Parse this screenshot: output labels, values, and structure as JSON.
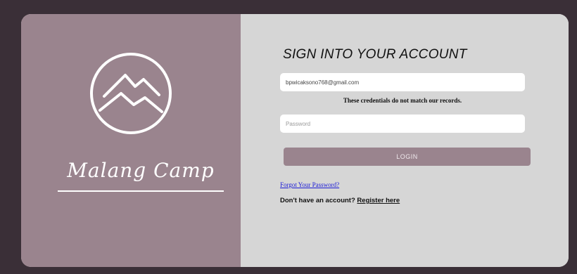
{
  "brand": {
    "name": "Malang Camp",
    "logo_icon": "mountain-circle-logo"
  },
  "login_form": {
    "title": "SIGN INTO YOUR ACCOUNT",
    "email_value": "bpwicaksono768@gmail.com",
    "error_message": "These credentials do not match our records.",
    "password_placeholder": "Password",
    "login_label": "LOGIN",
    "forgot_label": "Forgot Your Password?",
    "register_prompt": "Don't have an account?",
    "register_label": "Register here"
  },
  "colors": {
    "accent": "#9a848e",
    "panel_bg": "#d6d6d6",
    "frame_bg": "#3a2f37",
    "link": "#1a1ad6"
  }
}
